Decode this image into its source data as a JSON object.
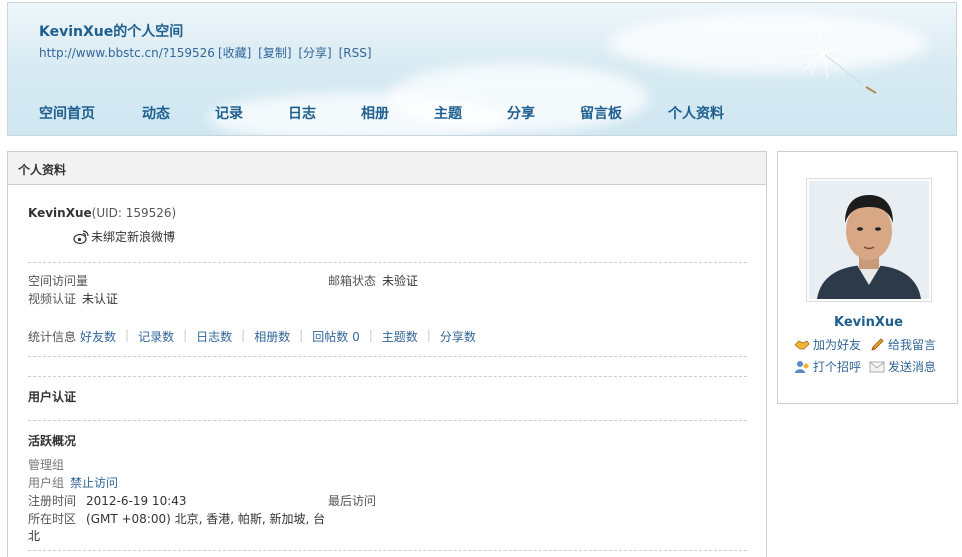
{
  "header": {
    "title": "KevinXue的个人空间",
    "url": "http://www.bbstc.cn/?159526",
    "links": [
      "[收藏]",
      "[复制]",
      "[分享]",
      "[RSS]"
    ],
    "nav": [
      "空间首页",
      "动态",
      "记录",
      "日志",
      "相册",
      "主题",
      "分享",
      "留言板",
      "个人资料"
    ]
  },
  "main": {
    "panel_title": "个人资料",
    "username": "KevinXue",
    "uid": "(UID: 159526)",
    "weibo": "未绑定新浪微博",
    "visits_label": "空间访问量",
    "email_label": "邮箱状态",
    "email_value": "未验证",
    "video_label": "视频认证",
    "video_value": "未认证",
    "stats_label": "统计信息",
    "stats": [
      "好友数",
      "记录数",
      "日志数",
      "相册数",
      "回帖数 0",
      "主题数",
      "分享数"
    ],
    "user_cert": "用户认证",
    "activity": "活跃概况",
    "admin_group": "管理组",
    "user_group_label": "用户组",
    "user_group_value": "禁止访问",
    "reg_label": "注册时间",
    "reg_value": "2012-6-19 10:43",
    "last_visit_label": "最后访问",
    "timezone_label": "所在时区",
    "timezone_value_1": "(GMT +08:00) 北京, 香港, 帕斯, 新加坡, 台",
    "timezone_value_2": "北"
  },
  "side": {
    "name": "KevinXue",
    "add_friend": "加为好友",
    "leave_message": "给我留言",
    "greet": "打个招呼",
    "send_message": "发送消息"
  },
  "colors": {
    "link": "#336699",
    "title": "#1f5f8f"
  }
}
